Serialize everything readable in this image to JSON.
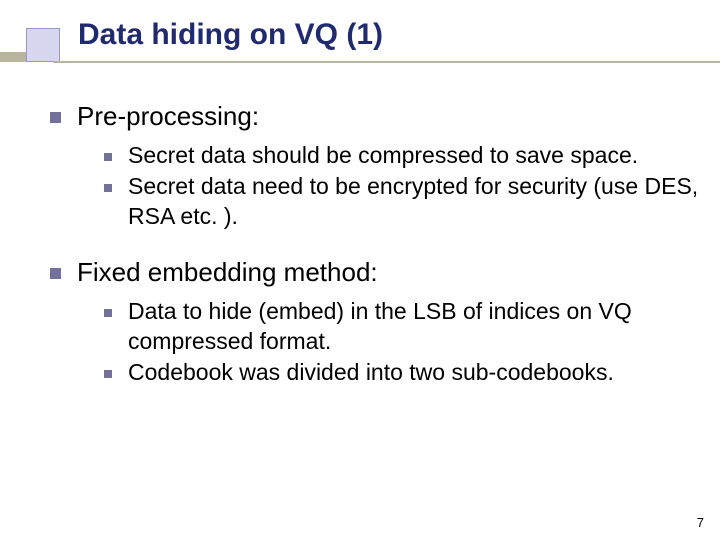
{
  "title": "Data hiding on VQ (1)",
  "sections": [
    {
      "heading": "Pre-processing:",
      "items": [
        "Secret data should be compressed to save space.",
        "Secret data need to be encrypted for security (use DES, RSA etc. )."
      ]
    },
    {
      "heading": "Fixed embedding method:",
      "items": [
        "Data to hide (embed) in the LSB of indices on VQ compressed format.",
        "Codebook was divided into two sub-codebooks."
      ]
    }
  ],
  "pageNumber": "7"
}
